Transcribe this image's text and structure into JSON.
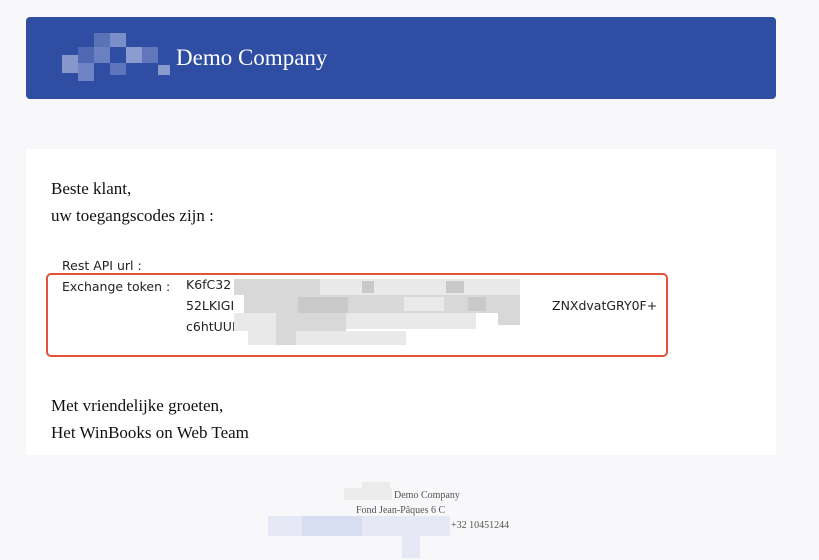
{
  "header": {
    "company_name": "Demo Company",
    "background_color": "#2f4da3",
    "logo": "pixelated-logo"
  },
  "message": {
    "greeting": "Beste klant,",
    "intro": "uw toegangscodes zijn :",
    "rest_api_label": "Rest API url :",
    "rest_api_value": "",
    "exchange_token_label": "Exchange token :",
    "token_line1_start": "K6fC32",
    "token_line2_start": "52LKIGI",
    "token_line2_end": "ZNXdvatGRY0F+",
    "token_line3_start": "c6htUUI",
    "highlight_color": "#e3533c",
    "closing_line1": "Met vriendelijke groeten,",
    "closing_line2": "Het WinBooks on Web Team"
  },
  "footer": {
    "company": "Demo Company",
    "address": "Fond Jean-Pâques 6 C",
    "phone": "+32 10451244"
  }
}
